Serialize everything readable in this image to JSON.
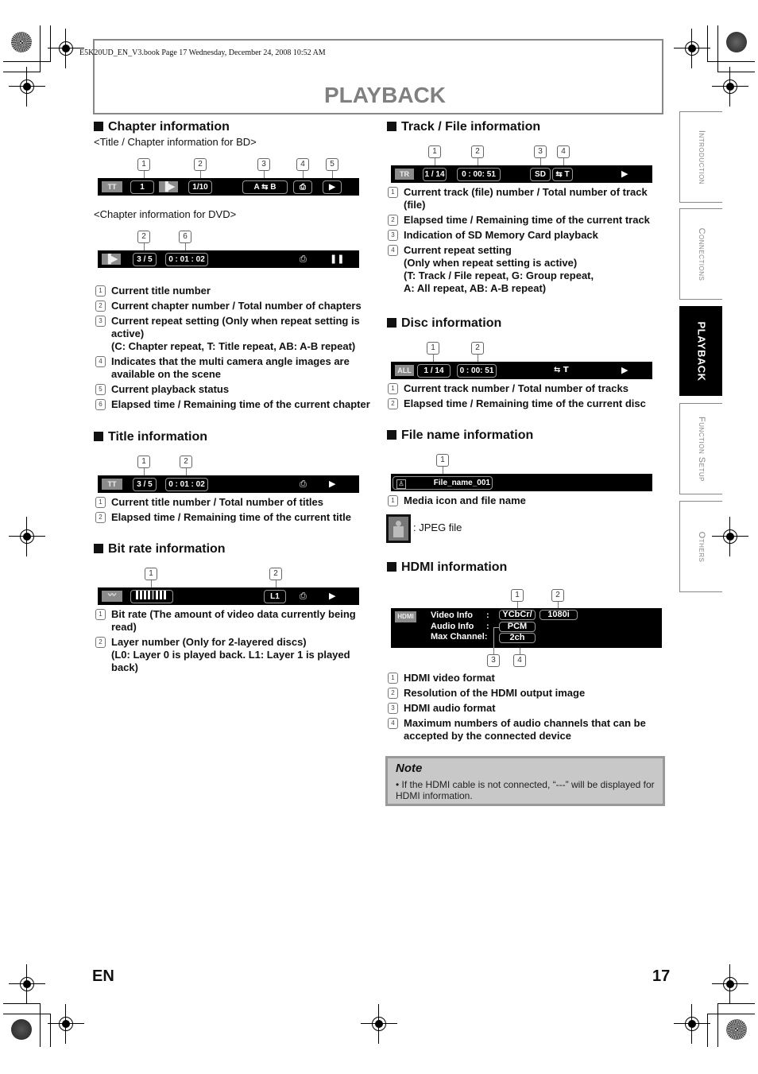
{
  "header": {
    "file_line": "E5K20UD_EN_V3.book  Page 17  Wednesday, December 24, 2008  10:52 AM",
    "page_title": "PLAYBACK"
  },
  "side_tabs": [
    {
      "label": "Introduction",
      "active": false
    },
    {
      "label": "Connections",
      "active": false
    },
    {
      "label": "PLAYBACK",
      "active": true
    },
    {
      "label": "Function Setup",
      "active": false
    },
    {
      "label": "Others",
      "active": false
    }
  ],
  "chapter_info": {
    "title": "Chapter information",
    "bd_subtitle": "<Title / Chapter information for BD>",
    "bd_bar": {
      "tag": "TT",
      "title_num": "1",
      "chapter": "1/10",
      "repeat": "A ⇆ B",
      "callouts": [
        "1",
        "2",
        "3",
        "4",
        "5"
      ]
    },
    "dvd_subtitle": "<Chapter information for DVD>",
    "dvd_bar": {
      "chapter": "3 / 5",
      "time": "0 : 01 : 02",
      "callouts": [
        "2",
        "6"
      ]
    },
    "items": [
      {
        "num": "1",
        "text": "Current title number"
      },
      {
        "num": "2",
        "text": "Current chapter number / Total number of chapters"
      },
      {
        "num": "3",
        "text": "Current repeat setting (Only when repeat setting is active)"
      },
      {
        "num": "",
        "text": "(C: Chapter repeat, T: Title repeat, AB: A-B repeat)"
      },
      {
        "num": "4",
        "text": "Indicates that the multi camera angle images are available on the scene"
      },
      {
        "num": "5",
        "text": "Current playback status"
      },
      {
        "num": "6",
        "text": "Elapsed time / Remaining time of the current chapter"
      }
    ]
  },
  "title_info": {
    "title": "Title information",
    "bar": {
      "tag": "TT",
      "title": "3 / 5",
      "time": "0 : 01 : 02",
      "callouts": [
        "1",
        "2"
      ]
    },
    "items": [
      {
        "num": "1",
        "text": "Current title number / Total number of titles"
      },
      {
        "num": "2",
        "text": "Elapsed time / Remaining time of the current title"
      }
    ]
  },
  "bitrate_info": {
    "title": "Bit rate information",
    "bar": {
      "layer": "L1",
      "bitrate_level": 0.6,
      "callouts": [
        "1",
        "2"
      ]
    },
    "items": [
      {
        "num": "1",
        "text": "Bit rate (The amount of video data currently being read)"
      },
      {
        "num": "2",
        "text": "Layer number (Only for 2-layered discs)"
      },
      {
        "num": "",
        "text": "(L0: Layer 0 is played back. L1: Layer 1 is played back)"
      }
    ]
  },
  "track_info": {
    "title": "Track / File information",
    "bar": {
      "tag": "TR",
      "track": "1 / 14",
      "time": "0 : 00: 51",
      "sd": "SD",
      "repeat": "⇆ T",
      "callouts": [
        "1",
        "2",
        "3",
        "4"
      ]
    },
    "items": [
      {
        "num": "1",
        "text": "Current track (file) number / Total number of track (file)"
      },
      {
        "num": "2",
        "text": "Elapsed time / Remaining time of the current track"
      },
      {
        "num": "3",
        "text": "Indication of SD Memory Card playback"
      },
      {
        "num": "4",
        "text": "Current repeat setting"
      },
      {
        "num": "",
        "text": "(Only when repeat setting is active)"
      },
      {
        "num": "",
        "text": "(T: Track / File repeat, G: Group repeat,"
      },
      {
        "num": "",
        "text": "A: All repeat, AB: A-B repeat)"
      }
    ]
  },
  "disc_info": {
    "title": "Disc information",
    "bar": {
      "tag": "ALL",
      "track": "1 / 14",
      "time": "0 : 00: 51",
      "repeat": "⇆ T",
      "callouts": [
        "1",
        "2"
      ]
    },
    "items": [
      {
        "num": "1",
        "text": "Current track number / Total number of tracks"
      },
      {
        "num": "2",
        "text": "Elapsed time / Remaining time of the current disc"
      }
    ]
  },
  "filename_info": {
    "title": "File name information",
    "bar": {
      "filename": "File_name_001",
      "callouts": [
        "1"
      ]
    },
    "items": [
      {
        "num": "1",
        "text": "Media icon and file name"
      }
    ],
    "jpeg_label": ": JPEG file"
  },
  "hdmi_info": {
    "title": "HDMI information",
    "bar": {
      "tag": "HDMI",
      "video_label": "Video Info",
      "audio_label": "Audio Info",
      "channel_label": "Max Channel:",
      "colon": ":",
      "video_format": "YCbCr/",
      "resolution": "1080i",
      "audio_format": "PCM",
      "channels": "2ch",
      "callouts": [
        "1",
        "2",
        "3",
        "4"
      ]
    },
    "items": [
      {
        "num": "1",
        "text": "HDMI video format"
      },
      {
        "num": "2",
        "text": "Resolution of the HDMI output image"
      },
      {
        "num": "3",
        "text": "HDMI audio format"
      },
      {
        "num": "4",
        "text": "Maximum numbers of audio channels that can be accepted by the connected device"
      }
    ]
  },
  "note": {
    "title": "Note",
    "text": "• If the HDMI cable is not connected, “---” will be displayed for HDMI information."
  },
  "footer": {
    "lang": "EN",
    "page": "17"
  }
}
